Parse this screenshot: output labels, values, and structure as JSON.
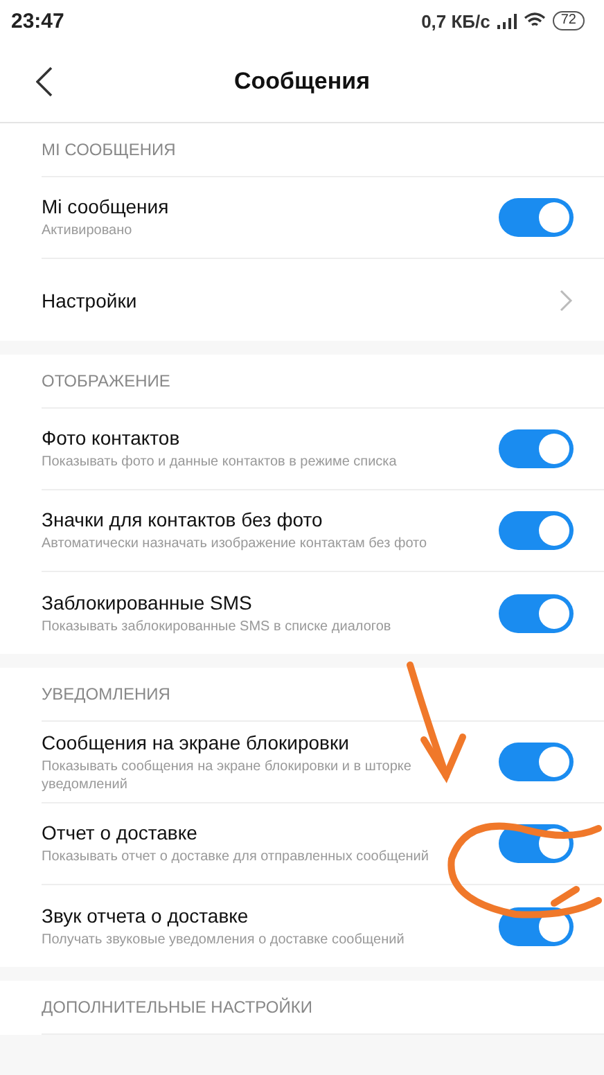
{
  "status_bar": {
    "time": "23:47",
    "speed": "0,7 КБ/с",
    "battery": "72"
  },
  "header": {
    "title": "Сообщения"
  },
  "sections": [
    {
      "title": "MI СООБЩЕНИЯ",
      "items": [
        {
          "kind": "toggle",
          "title": "Mi сообщения",
          "subtitle": "Активировано",
          "on": true
        },
        {
          "kind": "link",
          "title": "Настройки"
        }
      ]
    },
    {
      "title": "ОТОБРАЖЕНИЕ",
      "items": [
        {
          "kind": "toggle",
          "title": "Фото контактов",
          "subtitle": "Показывать фото и данные контактов в режиме списка",
          "on": true
        },
        {
          "kind": "toggle",
          "title": "Значки для контактов без фото",
          "subtitle": "Автоматически назначать изображение контактам без фото",
          "on": true
        },
        {
          "kind": "toggle",
          "title": "Заблокированные SMS",
          "subtitle": "Показывать заблокированные SMS в списке диалогов",
          "on": true
        }
      ]
    },
    {
      "title": "УВЕДОМЛЕНИЯ",
      "items": [
        {
          "kind": "toggle",
          "title": "Сообщения на экране блокировки",
          "subtitle": "Показывать сообщения на экране блокировки и в шторке уведомлений",
          "on": true
        },
        {
          "kind": "toggle",
          "title": "Отчет о доставке",
          "subtitle": "Показывать отчет о доставке для отправленных сообщений",
          "on": true
        },
        {
          "kind": "toggle",
          "title": "Звук отчета о доставке",
          "subtitle": "Получать звуковые уведомления о доставке сообщений",
          "on": true
        }
      ]
    },
    {
      "title": "ДОПОЛНИТЕЛЬНЫЕ НАСТРОЙКИ"
    }
  ],
  "annotations": {
    "arrow": true,
    "circle": true
  }
}
